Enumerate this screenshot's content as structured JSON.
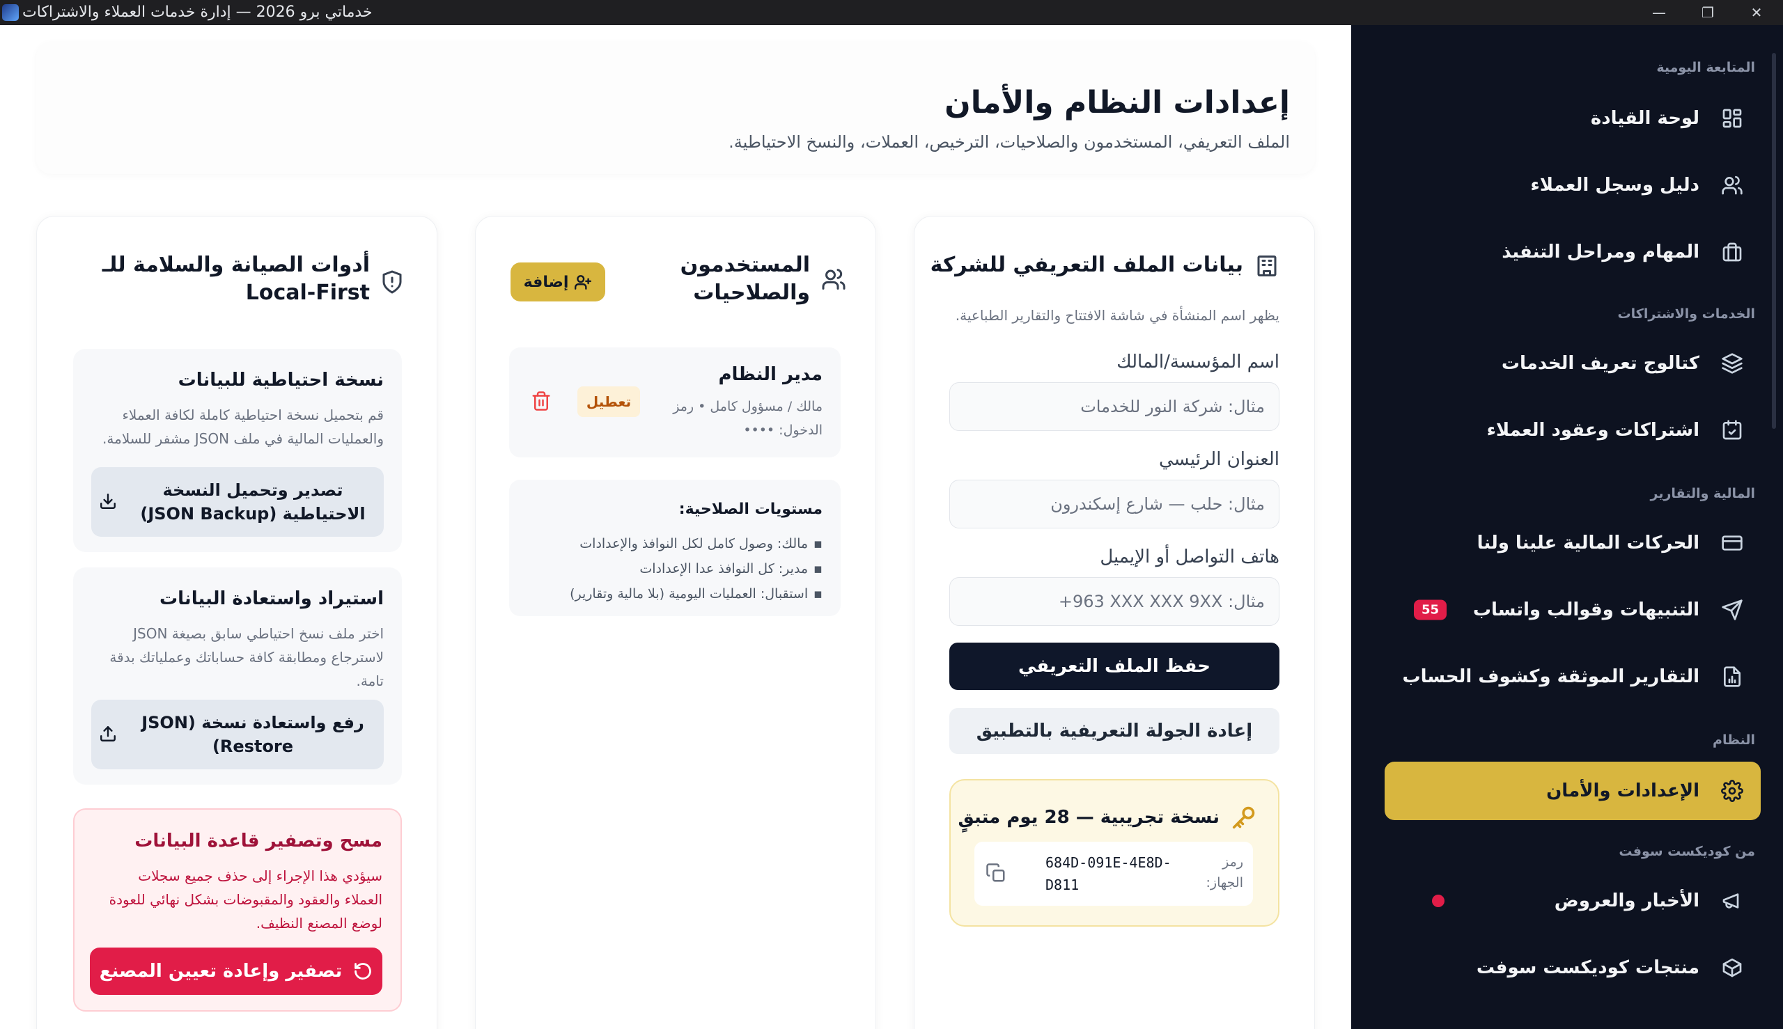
{
  "window": {
    "title": "خدماتي برو 2026 — إدارة خدمات العملاء والاشتراكات",
    "minimize": "—",
    "maximize": "❐",
    "close": "✕"
  },
  "sidebar": {
    "sections": {
      "daily": "المتابعة اليومية",
      "services": "الخدمات والاشتراكات",
      "finance": "المالية والتقارير",
      "system": "النظام",
      "vendor": "من كوديكست سوفت"
    },
    "items": [
      {
        "label": "لوحة القيادة",
        "icon": "dashboard-icon"
      },
      {
        "label": "دليل وسجل العملاء",
        "icon": "users-icon"
      },
      {
        "label": "المهام ومراحل التنفيذ",
        "icon": "briefcase-icon"
      },
      {
        "label": "كتالوج تعريف الخدمات",
        "icon": "layers-icon"
      },
      {
        "label": "اشتراكات وعقود العملاء",
        "icon": "calendar-check-icon"
      },
      {
        "label": "الحركات المالية علينا ولنا",
        "icon": "credit-card-icon"
      },
      {
        "label": "التنبيهات وقوالب واتساب",
        "icon": "send-icon",
        "badge": "55"
      },
      {
        "label": "التقارير الموثقة وكشوف الحساب",
        "icon": "file-chart-icon"
      },
      {
        "label": "الإعدادات والأمان",
        "icon": "settings-icon",
        "active": true
      },
      {
        "label": "الأخبار والعروض",
        "icon": "megaphone-icon",
        "dot": true
      },
      {
        "label": "منتجات كوديكست سوفت",
        "icon": "package-icon"
      }
    ]
  },
  "header": {
    "title": "إعدادات النظام والأمان",
    "subtitle": "الملف التعريفي، المستخدمون والصلاحيات، الترخيص، العملات، والنسخ الاحتياطية."
  },
  "profile": {
    "title": "بيانات الملف التعريفي للشركة",
    "description": "يظهر اسم المنشأة في شاشة الافتتاح والتقارير الطباعية.",
    "fields": {
      "name_label": "اسم المؤسسة/المالك",
      "name_placeholder": "مثال: شركة النور للخدمات",
      "address_label": "العنوان الرئيسي",
      "address_placeholder": "مثال: حلب — شارع إسكندرون",
      "contact_label": "هاتف التواصل أو الإيميل",
      "contact_placeholder": "مثال: ‎+963 XXX XXX 9XX"
    },
    "save_button": "حفظ الملف التعريفي",
    "tour_button": "إعادة الجولة التعريفية بالتطبيق",
    "license": {
      "title": "نسخة تجريبية — 28 يوم متبقٍ",
      "device_label": "رمز الجهاز:",
      "device_code": "684D-091E-4E8D-D811"
    }
  },
  "users": {
    "title": "المستخدمون والصلاحيات",
    "add_button": "إضافة",
    "user": {
      "name": "مدير النظام",
      "role": "مالك / مسؤول كامل • رمز الدخول: ••••",
      "disable_button": "تعطيل"
    },
    "permissions": {
      "title": "مستويات الصلاحية:",
      "levels": [
        "مالك: وصول كامل لكل النوافذ والإعدادات",
        "مدير: كل النوافذ عدا الإعدادات",
        "استقبال: العمليات اليومية (بلا مالية وتقارير)"
      ]
    }
  },
  "maintenance": {
    "title": "أدوات الصيانة والسلامة للـ Local-First",
    "backup": {
      "title": "نسخة احتياطية للبيانات",
      "description": "قم بتحميل نسخة احتياطية كاملة لكافة العملاء والعمليات المالية في ملف JSON مشفر للسلامة.",
      "button": "تصدير وتحميل النسخة الاحتياطية (JSON Backup)"
    },
    "restore": {
      "title": "استيراد واستعادة البيانات",
      "description": "اختر ملف نسخ احتياطي سابق بصيغة JSON لاسترجاع ومطابقة كافة حساباتك وعملياتك بدقة تامة.",
      "button": "رفع واستعادة نسخة (JSON Restore)"
    },
    "reset": {
      "title": "مسح وتصفير قاعدة البيانات",
      "description": "سيؤدي هذا الإجراء إلى حذف جميع سجلات العملاء والعقود والمقبوضات بشكل نهائي للعودة لوضع المصنع النظيف.",
      "button": "تصفير وإعادة تعيين المصنع"
    }
  },
  "colors": {
    "accent": "#d8b63f",
    "sidebar_bg": "#0d1220",
    "danger": "#e11d48",
    "primary_button": "#0f172a"
  }
}
